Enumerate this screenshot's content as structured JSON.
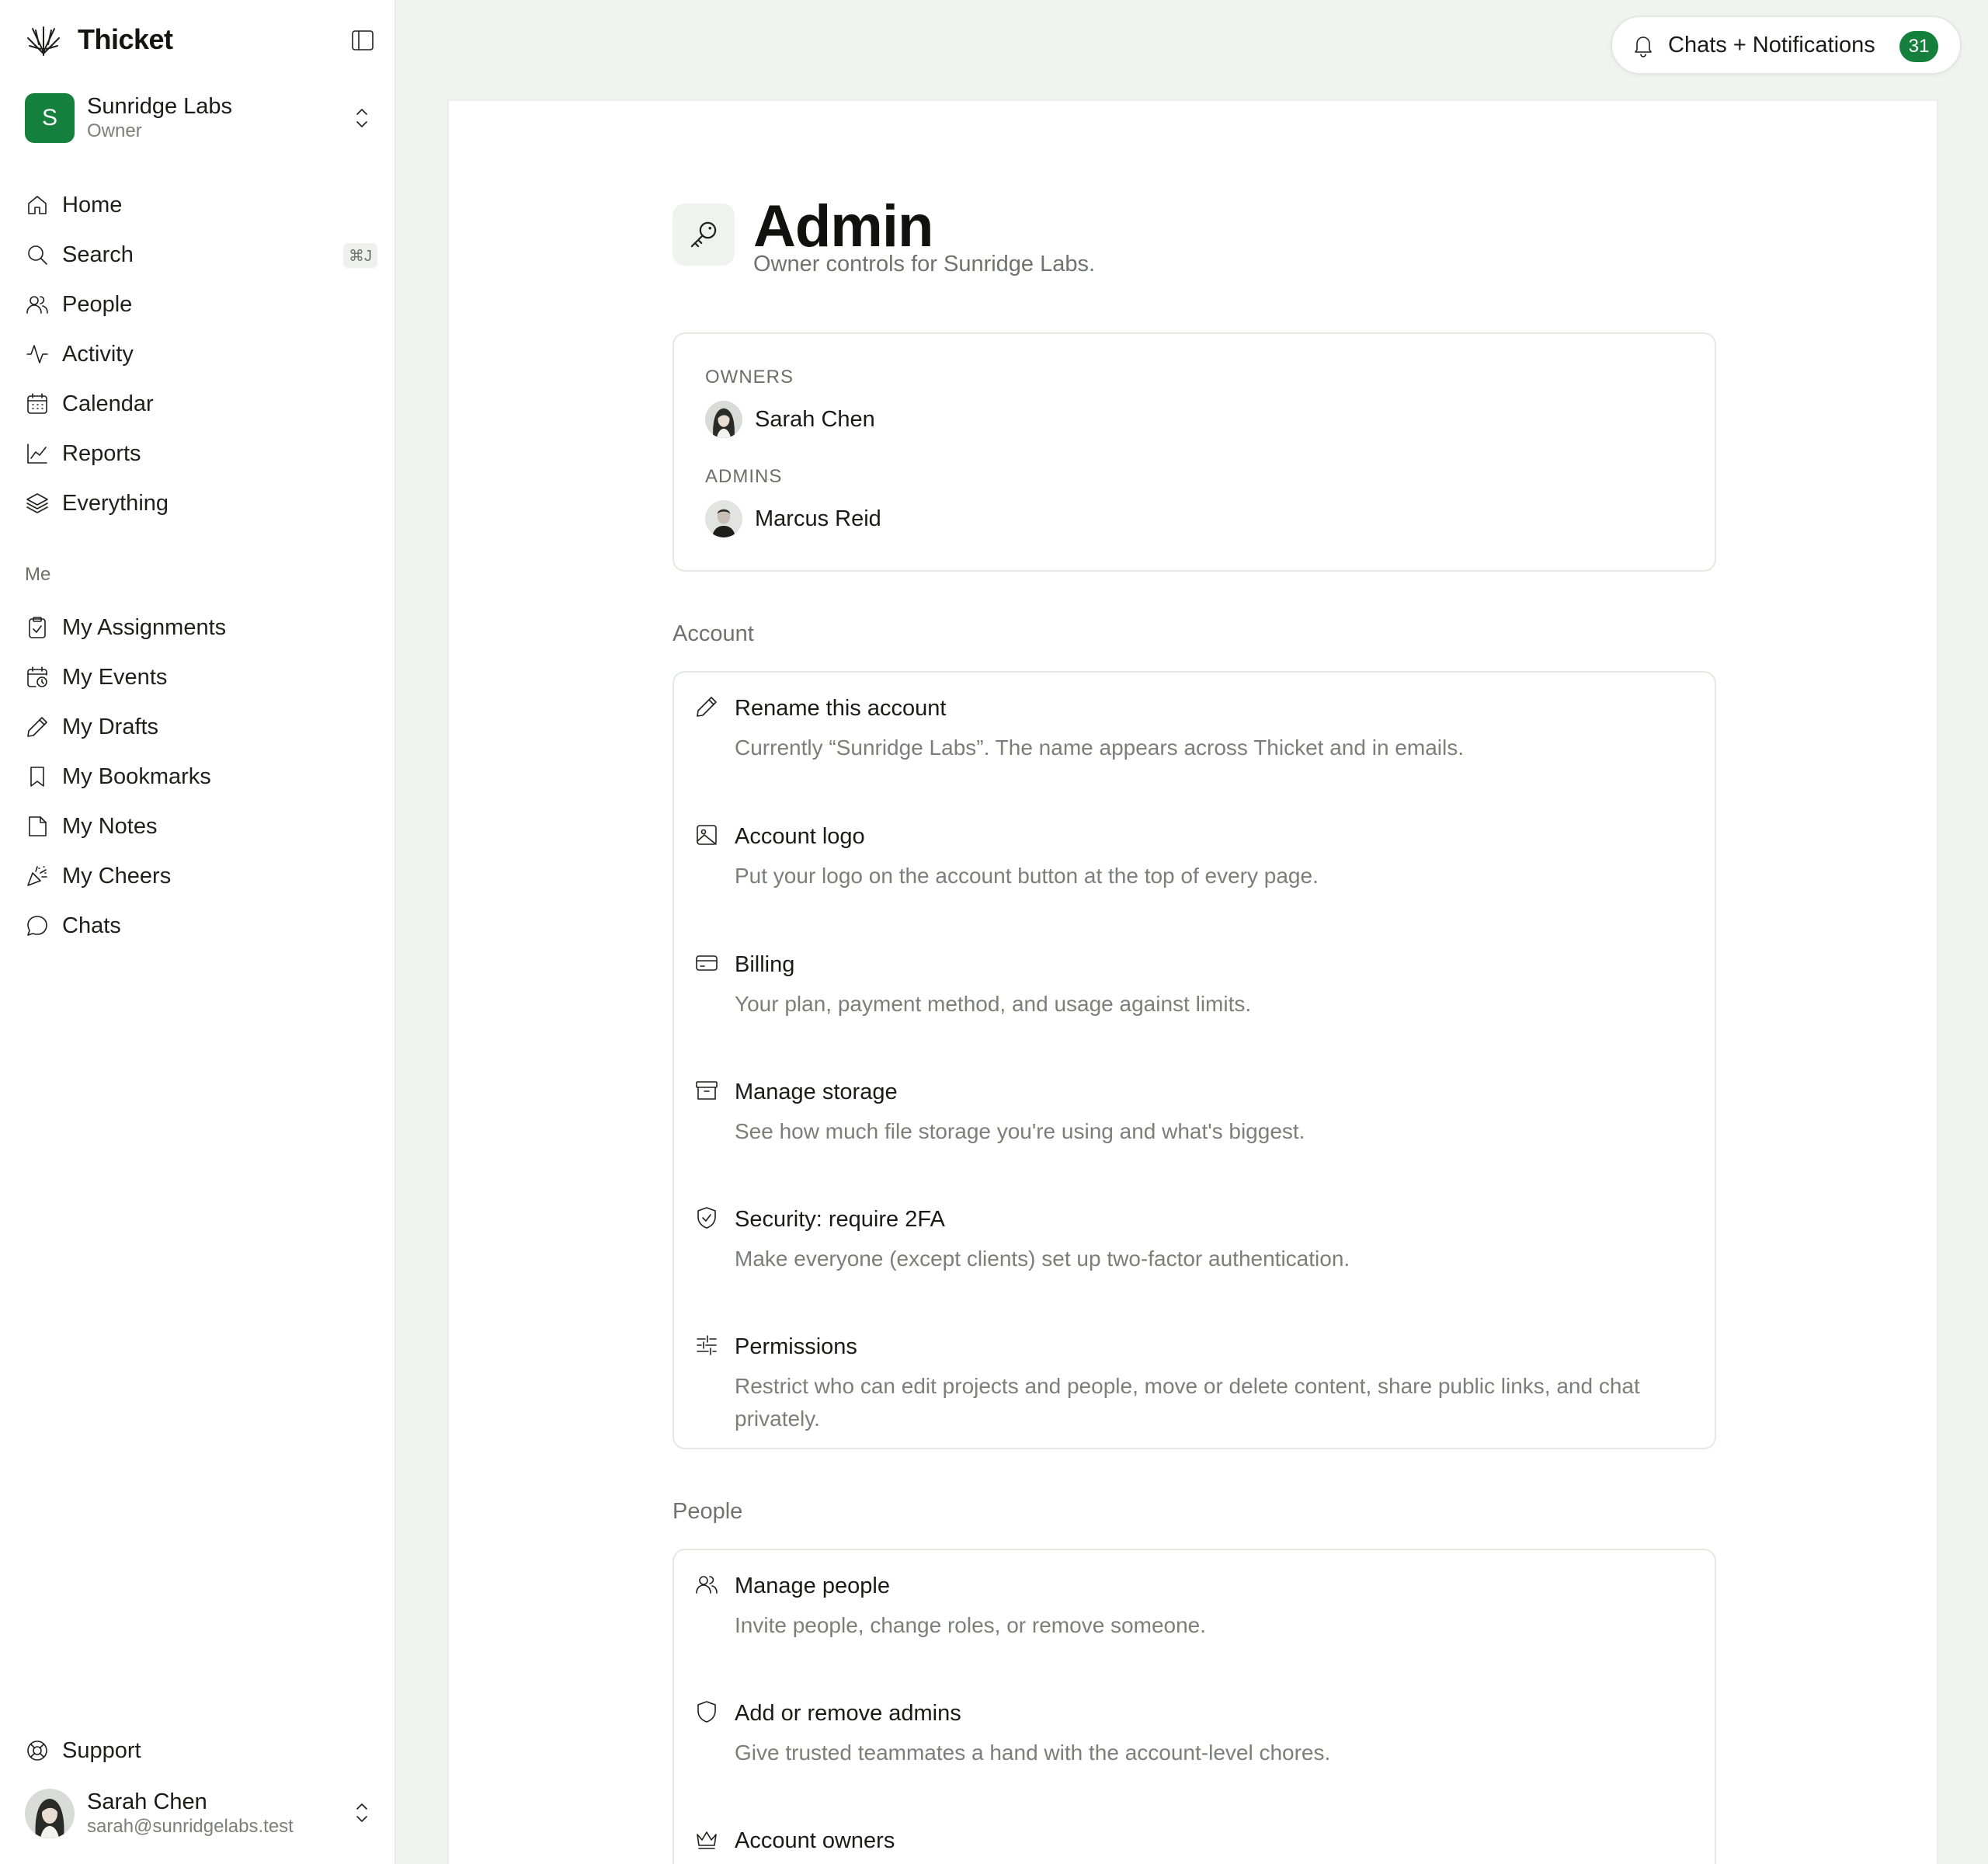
{
  "app": {
    "name": "Thicket"
  },
  "account": {
    "name": "Sunridge Labs",
    "initial": "S",
    "role": "Owner",
    "color": "#15803d"
  },
  "nav": {
    "main": [
      {
        "label": "Home",
        "icon": "home-icon"
      },
      {
        "label": "Search",
        "icon": "search-icon",
        "shortcut": "⌘J"
      },
      {
        "label": "People",
        "icon": "people-icon"
      },
      {
        "label": "Activity",
        "icon": "activity-icon"
      },
      {
        "label": "Calendar",
        "icon": "calendar-icon"
      },
      {
        "label": "Reports",
        "icon": "chart-line-icon"
      },
      {
        "label": "Everything",
        "icon": "layers-icon"
      }
    ],
    "section_label": "Me",
    "me": [
      {
        "label": "My Assignments",
        "icon": "clipboard-check-icon"
      },
      {
        "label": "My Events",
        "icon": "calendar-clock-icon"
      },
      {
        "label": "My Drafts",
        "icon": "pencil-icon"
      },
      {
        "label": "My Bookmarks",
        "icon": "bookmark-icon"
      },
      {
        "label": "My Notes",
        "icon": "note-icon"
      },
      {
        "label": "My Cheers",
        "icon": "party-popper-icon"
      },
      {
        "label": "Chats",
        "icon": "chat-bubble-icon"
      }
    ],
    "support": "Support"
  },
  "user": {
    "name": "Sarah Chen",
    "email": "sarah@sunridgelabs.test"
  },
  "notifications": {
    "label": "Chats + Notifications",
    "count": "31"
  },
  "page": {
    "title": "Admin",
    "subtitle": "Owner controls for Sunridge Labs."
  },
  "roles": {
    "owners_heading": "OWNERS",
    "owners": [
      "Sarah Chen"
    ],
    "admins_heading": "ADMINS",
    "admins": [
      "Marcus Reid"
    ]
  },
  "sections": {
    "account": {
      "label": "Account",
      "items": [
        {
          "title": "Rename this account",
          "desc": "Currently “Sunridge Labs”. The name appears across Thicket and in emails.",
          "icon": "pencil-icon"
        },
        {
          "title": "Account logo",
          "desc": "Put your logo on the account button at the top of every page.",
          "icon": "image-icon"
        },
        {
          "title": "Billing",
          "desc": "Your plan, payment method, and usage against limits.",
          "icon": "credit-card-icon"
        },
        {
          "title": "Manage storage",
          "desc": "See how much file storage you're using and what's biggest.",
          "icon": "archive-icon"
        },
        {
          "title": "Security: require 2FA",
          "desc": "Make everyone (except clients) set up two-factor authentication.",
          "icon": "shield-check-icon"
        },
        {
          "title": "Permissions",
          "desc": "Restrict who can edit projects and people, move or delete content, share public links, and chat privately.",
          "icon": "sliders-icon"
        }
      ]
    },
    "people": {
      "label": "People",
      "items": [
        {
          "title": "Manage people",
          "desc": "Invite people, change roles, or remove someone.",
          "icon": "people-icon"
        },
        {
          "title": "Add or remove admins",
          "desc": "Give trusted teammates a hand with the account-level chores.",
          "icon": "shield-icon"
        },
        {
          "title": "Account owners",
          "desc": "",
          "icon": "crown-icon"
        }
      ]
    }
  }
}
